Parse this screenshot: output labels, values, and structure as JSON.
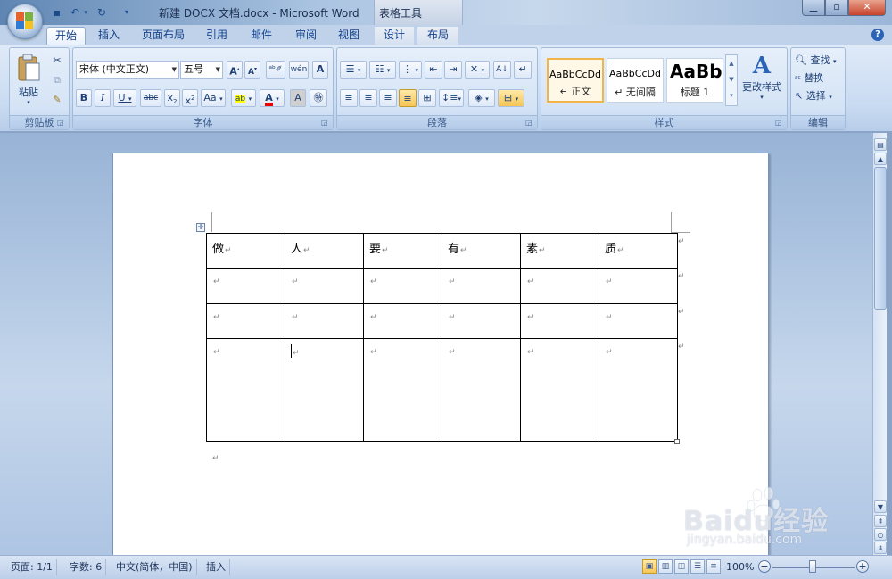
{
  "window": {
    "title": "新建 DOCX 文档.docx - Microsoft Word",
    "contextual_title": "表格工具"
  },
  "tabs": [
    {
      "label": "开始",
      "active": true
    },
    {
      "label": "插入"
    },
    {
      "label": "页面布局"
    },
    {
      "label": "引用"
    },
    {
      "label": "邮件"
    },
    {
      "label": "审阅"
    },
    {
      "label": "视图"
    },
    {
      "label": "设计",
      "contextual": true
    },
    {
      "label": "布局",
      "contextual": true
    }
  ],
  "ribbon": {
    "clipboard": {
      "label": "剪贴板",
      "paste": "粘贴"
    },
    "font": {
      "label": "字体",
      "font_name": "宋体 (中文正文)",
      "font_size": "五号"
    },
    "paragraph": {
      "label": "段落"
    },
    "styles": {
      "label": "样式",
      "items": [
        {
          "sample": "AaBbCcDd",
          "name": "↵ 正文",
          "selected": true
        },
        {
          "sample": "AaBbCcDd",
          "name": "↵ 无间隔"
        },
        {
          "sample": "AaBb",
          "name": "标题 1"
        }
      ],
      "change_styles": "更改样式"
    },
    "editing": {
      "label": "编辑",
      "find": "查找",
      "replace": "替换",
      "select": "选择"
    }
  },
  "document": {
    "table": {
      "rows": [
        [
          "做",
          "人",
          "要",
          "有",
          "素",
          "质"
        ],
        [
          "",
          "",
          "",
          "",
          "",
          ""
        ],
        [
          "",
          "",
          "",
          "",
          "",
          ""
        ],
        [
          "",
          "",
          "",
          "",
          "",
          ""
        ]
      ]
    }
  },
  "status": {
    "page": "页面: 1/1",
    "words": "字数: 6",
    "language": "中文(简体，中国)",
    "mode": "插入",
    "zoom": "100%"
  },
  "watermark": {
    "brand": "Baidu经验",
    "url": "jingyan.baidu.com"
  }
}
